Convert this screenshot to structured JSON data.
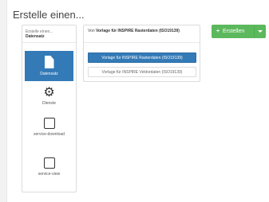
{
  "header": {
    "title": "Erstelle einen..."
  },
  "type_panel": {
    "subtitle": "Erstelle einen...",
    "heading": "Datensatz",
    "tiles": [
      {
        "label": "Datensatz",
        "icon": "document-icon",
        "active": true
      },
      {
        "label": "Dienste",
        "icon": "gear-icon",
        "active": false
      },
      {
        "label": "service-download",
        "icon": "checkbox-icon",
        "active": false
      },
      {
        "label": "service-view",
        "icon": "checkbox-icon",
        "active": false
      }
    ]
  },
  "template_panel": {
    "prefix": "Von",
    "heading": "Vorlage für INSPIRE Rasterdaten (ISO19139)",
    "items": [
      {
        "label": "Vorlage für INSPIRE Rasterdaten (ISO19139)",
        "active": true
      },
      {
        "label": "Vorlage für INSPIRE Vektordaten (ISO19139)",
        "active": false
      }
    ]
  },
  "create_button": {
    "label": "Erstellen",
    "icon": "plus-icon"
  },
  "colors": {
    "primary": "#337ab7",
    "success": "#5cb85c"
  }
}
